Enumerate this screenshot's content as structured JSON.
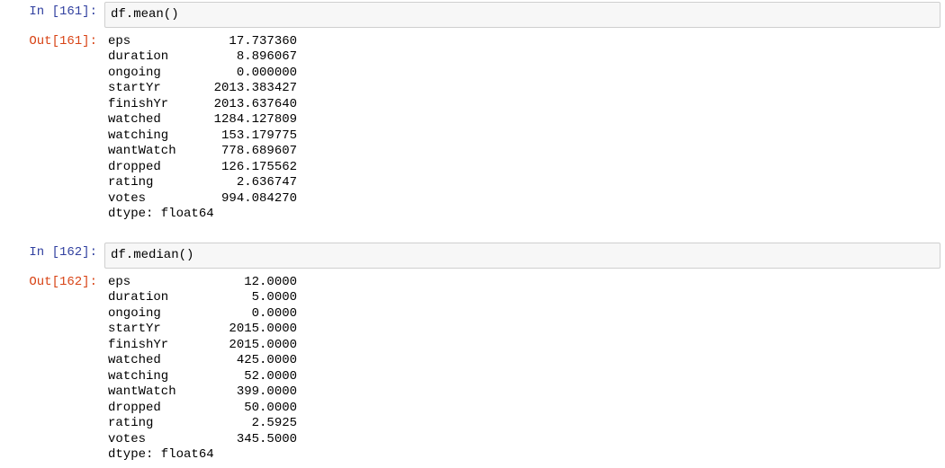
{
  "cells": [
    {
      "in_prompt": "In [161]:",
      "code": "df.mean()",
      "out_prompt": "Out[161]:",
      "output_rows": [
        {
          "label": "eps",
          "value": "17.737360"
        },
        {
          "label": "duration",
          "value": "8.896067"
        },
        {
          "label": "ongoing",
          "value": "0.000000"
        },
        {
          "label": "startYr",
          "value": "2013.383427"
        },
        {
          "label": "finishYr",
          "value": "2013.637640"
        },
        {
          "label": "watched",
          "value": "1284.127809"
        },
        {
          "label": "watching",
          "value": "153.179775"
        },
        {
          "label": "wantWatch",
          "value": "778.689607"
        },
        {
          "label": "dropped",
          "value": "126.175562"
        },
        {
          "label": "rating",
          "value": "2.636747"
        },
        {
          "label": "votes",
          "value": "994.084270"
        }
      ],
      "dtype_line": "dtype: float64"
    },
    {
      "in_prompt": "In [162]:",
      "code": "df.median()",
      "out_prompt": "Out[162]:",
      "output_rows": [
        {
          "label": "eps",
          "value": "12.0000"
        },
        {
          "label": "duration",
          "value": "5.0000"
        },
        {
          "label": "ongoing",
          "value": "0.0000"
        },
        {
          "label": "startYr",
          "value": "2015.0000"
        },
        {
          "label": "finishYr",
          "value": "2015.0000"
        },
        {
          "label": "watched",
          "value": "425.0000"
        },
        {
          "label": "watching",
          "value": "52.0000"
        },
        {
          "label": "wantWatch",
          "value": "399.0000"
        },
        {
          "label": "dropped",
          "value": "50.0000"
        },
        {
          "label": "rating",
          "value": "2.5925"
        },
        {
          "label": "votes",
          "value": "345.5000"
        }
      ],
      "dtype_line": "dtype: float64"
    }
  ],
  "layout": {
    "label_width": 11,
    "value_width": 14
  }
}
